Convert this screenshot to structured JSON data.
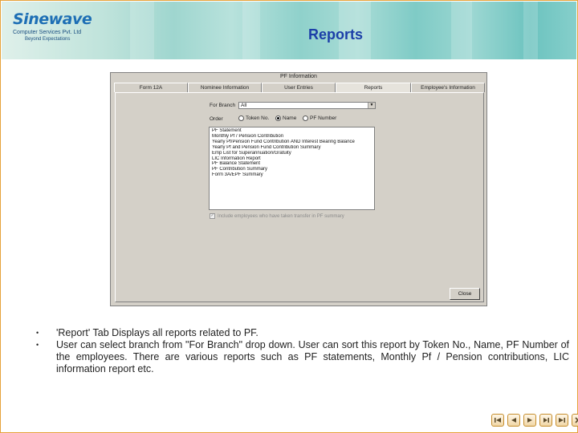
{
  "header": {
    "logo_name": "Sinewave",
    "logo_subtitle": "Computer Services Pvt. Ltd",
    "logo_tagline": "Beyond Expectations",
    "title": "Reports"
  },
  "app": {
    "window_title": "PF Information",
    "tabs": [
      {
        "label": "Form 12A",
        "active": false
      },
      {
        "label": "Nominee Information",
        "active": false
      },
      {
        "label": "User Entries",
        "active": false
      },
      {
        "label": "Reports",
        "active": true
      },
      {
        "label": "Employee's Information",
        "active": false
      }
    ],
    "branch_label": "For Branch",
    "branch_value": "All",
    "order_label": "Order",
    "order_options": [
      {
        "label": "Token No.",
        "selected": false
      },
      {
        "label": "Name",
        "selected": true
      },
      {
        "label": "PF Number",
        "selected": false
      }
    ],
    "reports": [
      "PF Statement",
      "Monthly Pf / Pension Contribution",
      "Yearly Pf/Pension Fund Contribution AND Interest Bearing Balance",
      "Yearly Pf and Pension Fund Contribution Summary",
      "Emp List for Superannuation/Gratuity",
      "LIC Information Report",
      "PF Balance Statement",
      "PF Contribution Summary",
      "Form 3A/EPF Summary"
    ],
    "include_checkbox_label": "Include employees who have taken transfer in PF summary",
    "close_label": "Close"
  },
  "bullets": [
    "'Report' Tab Displays all reports related to PF.",
    "User can select branch from \"For Branch\" drop down. User can sort this report by Token No., Name, PF Number of the employees. There are various reports such as PF statements, Monthly Pf / Pension contributions, LIC information report etc."
  ],
  "bullet_mark": "•",
  "nav_icons": [
    "first-slide-icon",
    "previous-slide-icon",
    "play-icon",
    "next-slide-icon",
    "last-slide-icon",
    "close-icon"
  ],
  "colors": {
    "title": "#1c3fa8",
    "logo": "#1e6fb5",
    "border": "#e6a23a"
  }
}
